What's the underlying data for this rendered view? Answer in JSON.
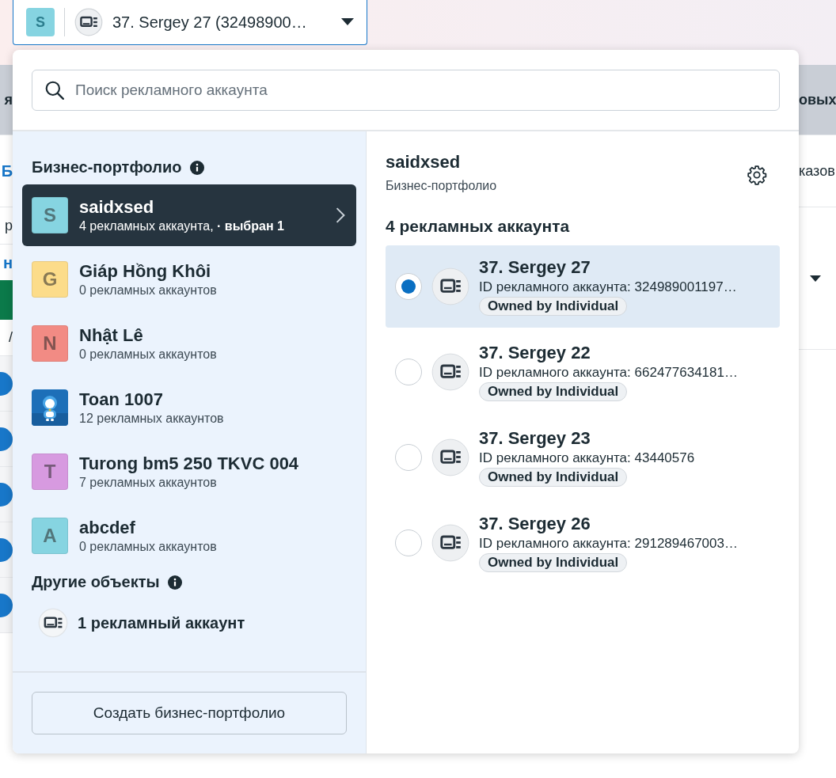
{
  "account_selector": {
    "avatar_letter": "S",
    "label": "37. Sergey 27 (32498900…"
  },
  "background": {
    "left_fragments": [
      {
        "kind": "band",
        "text": "я"
      },
      {
        "kind": "tab",
        "text": "Б"
      },
      {
        "kind": "text",
        "text": "р"
      },
      {
        "kind": "link",
        "text": "н"
      },
      {
        "kind": "block"
      },
      {
        "kind": "text",
        "text": "/"
      },
      {
        "kind": "dot"
      },
      {
        "kind": "dot"
      },
      {
        "kind": "dot"
      },
      {
        "kind": "dot"
      },
      {
        "kind": "dot"
      }
    ],
    "right_fragments": [
      {
        "kind": "band",
        "text": "овых"
      },
      {
        "kind": "text",
        "text": "казов"
      },
      {
        "kind": "caret"
      }
    ]
  },
  "dropdown": {
    "search": {
      "placeholder": "Поиск рекламного аккаунта"
    },
    "portfolios_heading": "Бизнес-портфолио",
    "portfolios": [
      {
        "kind": "letter",
        "letter": "S",
        "color": "#86d4e1",
        "name": "saidxsed",
        "subtitle": "4 рекламных аккаунта, **· выбран 1**",
        "selected": true
      },
      {
        "kind": "letter",
        "letter": "G",
        "color": "#fcdc8a",
        "name": "Giáp Hồng Khôi",
        "subtitle": "0 рекламных аккаунтов",
        "selected": false
      },
      {
        "kind": "letter",
        "letter": "N",
        "color": "#f28b84",
        "name": "Nhật Lê",
        "subtitle": "0 рекламных аккаунтов",
        "selected": false
      },
      {
        "kind": "picture",
        "name": "Toan 1007",
        "subtitle": "12 рекламных аккаунтов",
        "selected": false
      },
      {
        "kind": "letter",
        "letter": "T",
        "color": "#d79ae0",
        "name": "Turong bm5 250 TKVC 004",
        "subtitle": "7 рекламных аккаунтов",
        "selected": false
      },
      {
        "kind": "letter",
        "letter": "A",
        "color": "#86d4e1",
        "name": "abcdef",
        "subtitle": "0 рекламных аккаунтов",
        "selected": false
      }
    ],
    "other_heading": "Другие объекты",
    "other_item": "1 рекламный аккаунт",
    "create_button": "Создать бизнес-портфолио"
  },
  "detail": {
    "title": "saidxsed",
    "subtitle": "Бизнес-портфолио",
    "count_heading": "4 рекламных аккаунта",
    "accounts": [
      {
        "name": "37. Sergey 27",
        "id": "ID рекламного аккаунта: 324989001197…",
        "tag": "Owned by Individual",
        "selected": true
      },
      {
        "name": "37. Sergey 22",
        "id": "ID рекламного аккаунта: 662477634181…",
        "tag": "Owned by Individual",
        "selected": false
      },
      {
        "name": "37. Sergey 23",
        "id": "ID рекламного аккаунта: 43440576",
        "tag": "Owned by Individual",
        "selected": false
      },
      {
        "name": "37. Sergey 26",
        "id": "ID рекламного аккаунта: 291289467003…",
        "tag": "Owned by Individual",
        "selected": false
      }
    ]
  }
}
